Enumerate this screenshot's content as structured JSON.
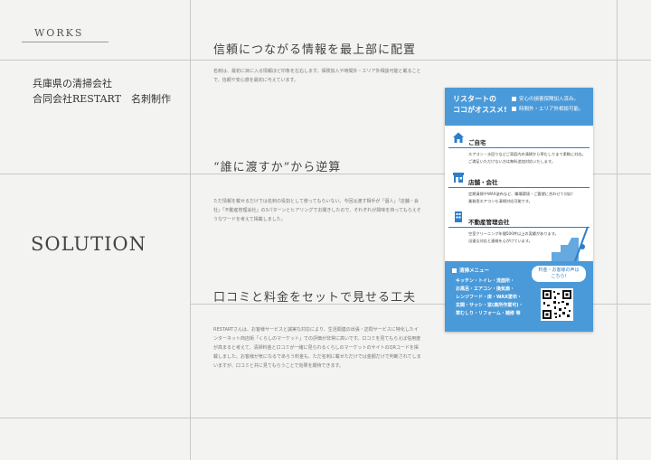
{
  "left": {
    "section_label": "WORKS",
    "client_line1": "兵庫県の清掃会社",
    "client_line2": "合同会社RESTART　名刺制作",
    "solution_label": "SOLUTION"
  },
  "sections": [
    {
      "title": "信頼につながる情報を最上部に配置",
      "text": "名刺は、最初に目に入る情報ほど印象を左右します。保険加入や時間外・エリア外相談可能と載ることで、信頼や安心感を最初に与えています。"
    },
    {
      "title": "“誰に渡すか”から逆算",
      "text": "ただ情報を載せるだけでは名刺の役割として使ってもらいない。今回は渡す相手が「個人」「店舗・会社」「不動産管理会社」の3パターンとヒアリングでお聞きしたので、それぞれが興味を持ってもらえそうなワードを考えて掲載しました。"
    },
    {
      "title": "口コミと料金をセットで見せる工夫",
      "text": "RESTARTさんは、お客様サービスと誠実な対応により、生活関連の出張・訪問サービスに特化したインターネット商店街「くらしのマーケット」での評価が非常に高いです。口コミを見てもらえば信用度が高まると考えて、清掃料金と口コミが一緒に見られるくらしのマーケットのサイトのQRコードを掲載しました。お客様が気になるであろう料金も、ただ名刺に載せただけでは金額だけで判断されてしまいますが、口コミと共に見てもらうことで効果を期待できます。"
    }
  ],
  "card": {
    "header_left_line1": "リスタートの",
    "header_left_line2": "ココがオススメ!",
    "header_points": [
      "安心の損害保険加入済み。",
      "時間外・エリア外相談可能。"
    ],
    "categories": [
      {
        "label": "ご自宅",
        "desc1": "エアコン・水回りなどご家庭内の清掃から草むしりまで柔軟に対応。",
        "desc2": "ご満足いただけない方は無料追加対応いたします。"
      },
      {
        "label": "店舗・会社",
        "desc1": "定期清掃やWAX塗布など、職場環境・ご要望に合わせて対応!",
        "desc2": "業務用エアコンも清掃対応可能です。"
      },
      {
        "label": "不動産管理会社",
        "desc1": "空室クリーニング年間500件以上の実績があります。",
        "desc2": "迅速な対応と連絡を心がけています。"
      }
    ],
    "menu_title": "清掃メニュー",
    "menu_items": [
      "キッチン・トイレ・洗面所・",
      "お風呂・エアコン・換気扇・",
      "レンジフード・床・WAX塗布・",
      "玄関・サッシ・窓(高所作業可)・",
      "草むしり・リフォーム・補修 等"
    ],
    "bubble_line1": "料金・お客様の声は",
    "bubble_line2": "こちら!",
    "accent_color": "#4a9ad9"
  }
}
